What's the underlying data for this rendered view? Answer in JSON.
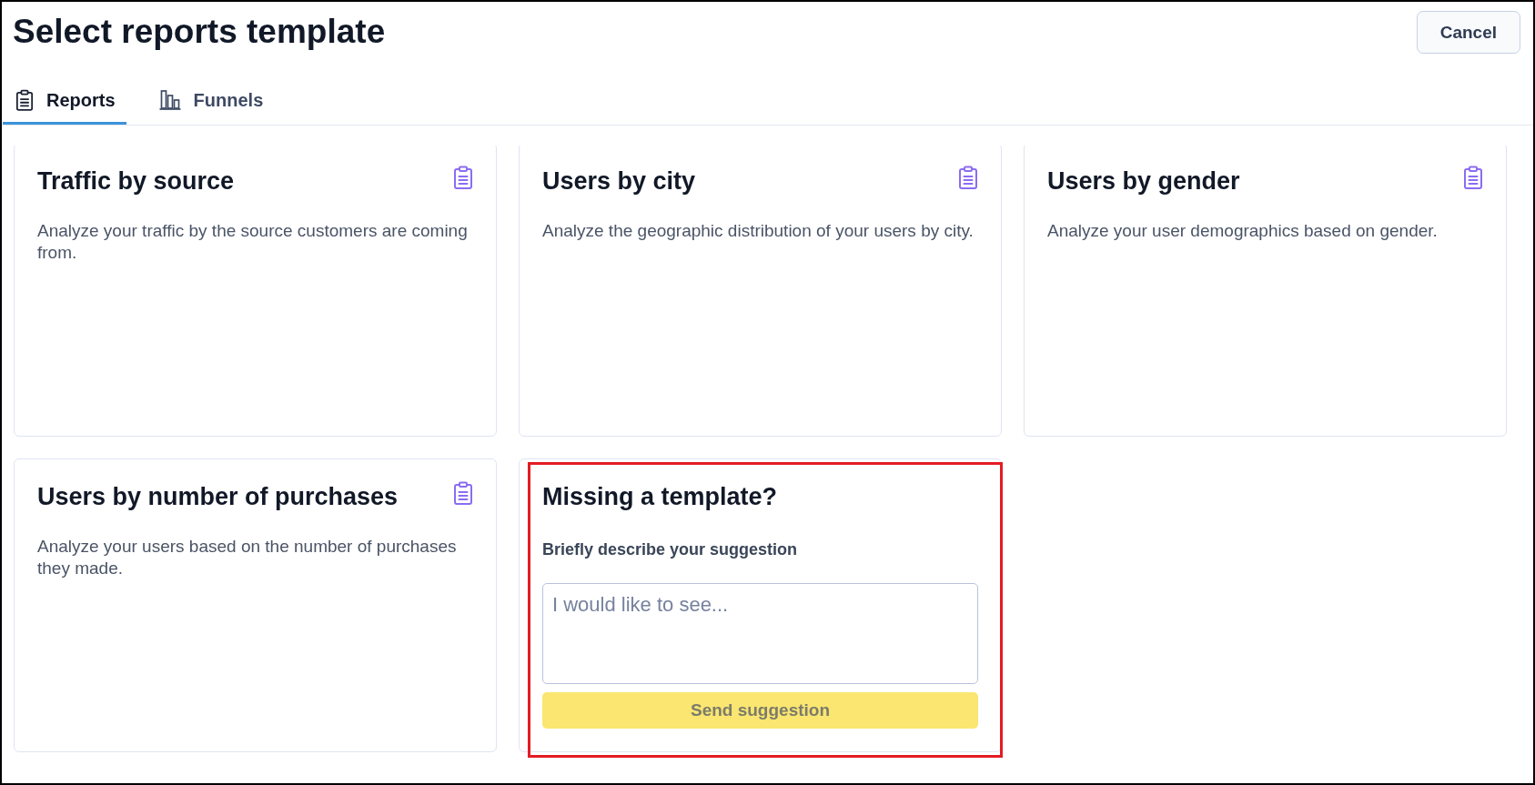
{
  "title": "Select reports template",
  "cancel_button": "Cancel",
  "tabs": [
    {
      "label": "Reports",
      "kind": "report",
      "selected": true
    },
    {
      "label": "Funnels",
      "kind": "funnel",
      "selected": false
    }
  ],
  "templates": [
    {
      "title": "Traffic by source",
      "description": "Analyze your traffic by the source customers are coming from."
    },
    {
      "title": "Users by city",
      "description": "Analyze the geographic distribution of your users by city."
    },
    {
      "title": "Users by gender",
      "description": "Analyze your user demographics based on gender."
    },
    {
      "title": "Users by number of purchases",
      "description": "Analyze your users based on the number of purchases they made."
    }
  ],
  "suggestion": {
    "title": "Missing a template?",
    "field_label": "Briefly describe your suggestion",
    "placeholder": "I would like to see...",
    "button": {
      "label": "Send suggestion",
      "disabled": true
    },
    "highlighted": true
  }
}
